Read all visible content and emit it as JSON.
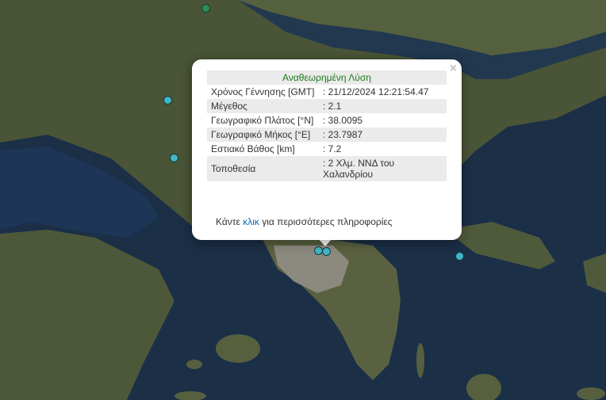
{
  "popup": {
    "close_label": "×",
    "title": "Αναθεωρημένη Λύση",
    "rows": [
      {
        "label": "Χρόνος Γέννησης [GMT]",
        "value": ": 21/12/2024 12:21:54.47"
      },
      {
        "label": "Μέγεθος",
        "value": ": 2.1"
      },
      {
        "label": "Γεωγραφικό Πλάτος [°N]",
        "value": ": 38.0095"
      },
      {
        "label": "Γεωγραφικό Μήκος [°E]",
        "value": ": 23.7987"
      },
      {
        "label": "Εστιακό Βάθος [km]",
        "value": ": 7.2"
      },
      {
        "label": "Τοποθεσία",
        "value": ": 2 Χλμ. ΝΝΔ του Χαλανδρίου"
      }
    ],
    "footer_prefix": "Κάντε ",
    "footer_link": "κλικ",
    "footer_suffix": " για περισσότερες πληροφορίες"
  },
  "markers": [
    {
      "name": "marker-north",
      "color": "#2e8b57"
    },
    {
      "name": "marker-west-1",
      "color": "#3fb6c6"
    },
    {
      "name": "marker-west-2",
      "color": "#3fb6c6"
    },
    {
      "name": "marker-athens-1",
      "color": "#3fb6c6"
    },
    {
      "name": "marker-athens-2",
      "color": "#3fb6c6"
    },
    {
      "name": "marker-east",
      "color": "#3fb6c6"
    }
  ]
}
